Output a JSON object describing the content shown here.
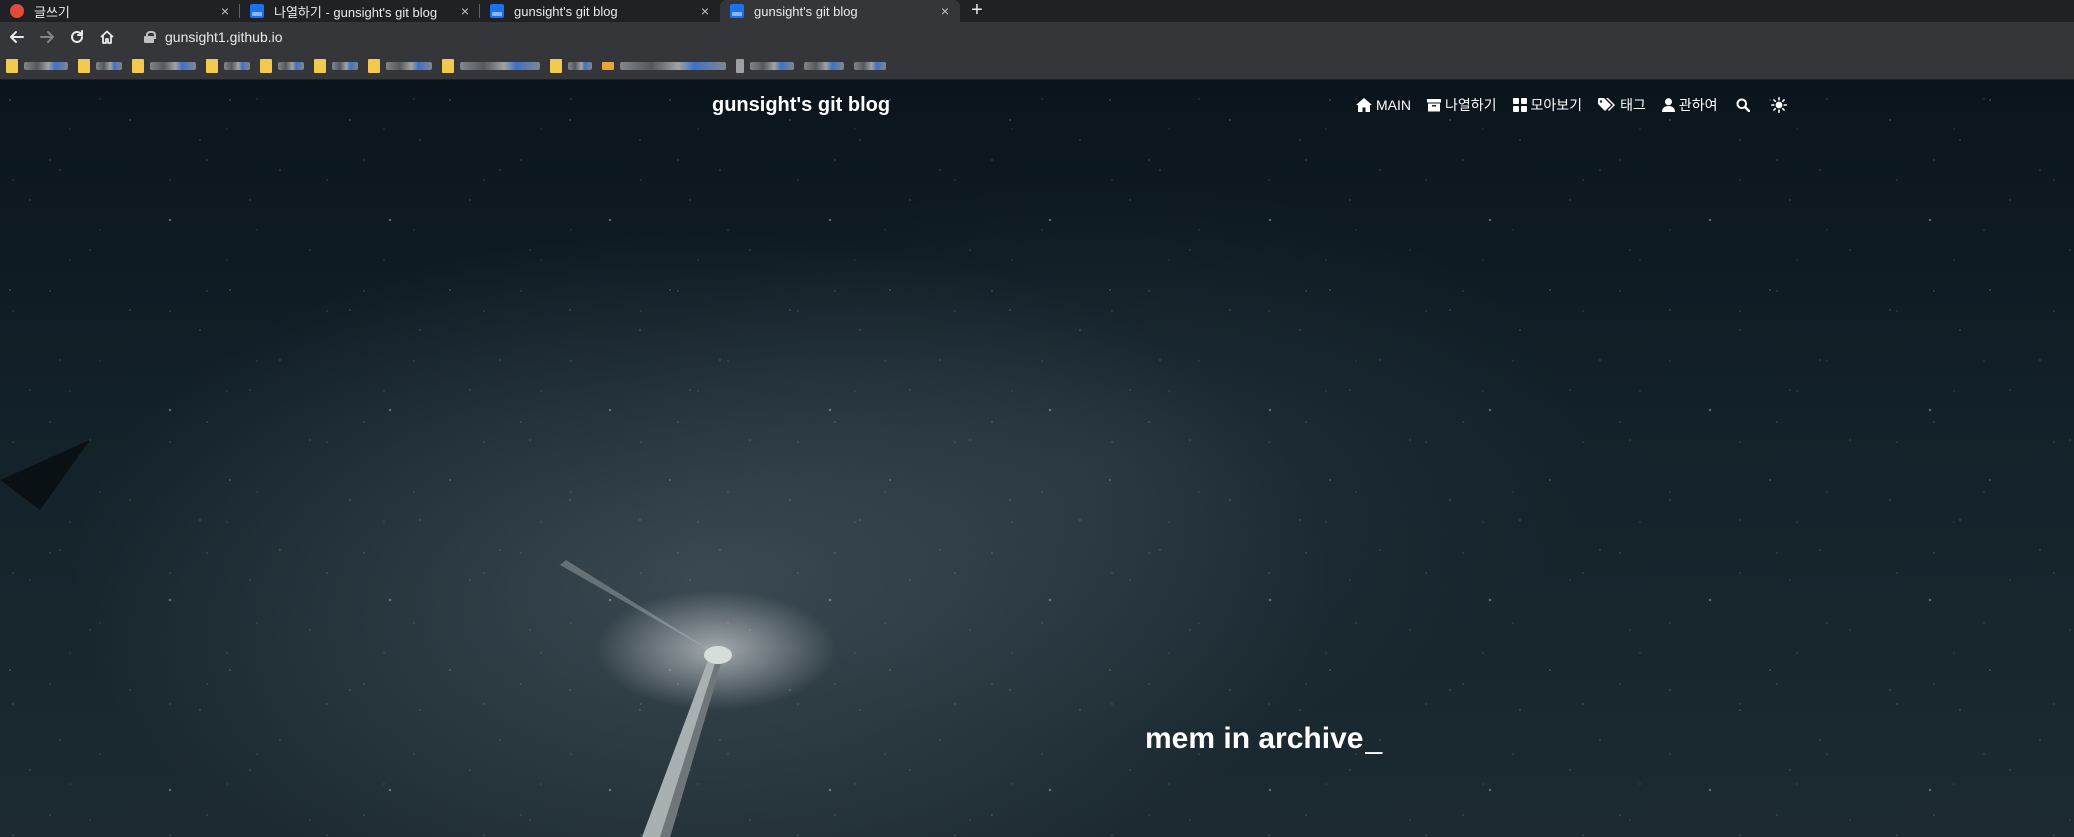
{
  "browser": {
    "tabs": [
      {
        "title": "글쓰기",
        "favicon": "red-circle-icon",
        "active": false
      },
      {
        "title": "나열하기 - gunsight's git blog",
        "favicon": "blog-icon",
        "active": false
      },
      {
        "title": "gunsight's git blog",
        "favicon": "blog-icon",
        "active": false
      },
      {
        "title": "gunsight's git blog",
        "favicon": "blog-icon",
        "active": true
      }
    ],
    "close_glyph": "×",
    "new_tab_glyph": "+",
    "url": "gunsight1.github.io"
  },
  "site": {
    "title": "gunsight's git blog",
    "nav": [
      {
        "label": "MAIN",
        "icon": "home-icon"
      },
      {
        "label": "나열하기",
        "icon": "archive-icon"
      },
      {
        "label": "모아보기",
        "icon": "grid-icon"
      },
      {
        "label": "태그",
        "icon": "tags-icon"
      },
      {
        "label": "관하여",
        "icon": "user-icon"
      }
    ],
    "search_icon": "search-icon",
    "theme_icon": "sun-icon"
  },
  "hero": {
    "text": "mem in archive",
    "cursor": "_"
  },
  "colors": {
    "tab_bg": "#202124",
    "toolbar_bg": "#35363a",
    "folder": "#f2c94c",
    "text": "#ffffff"
  }
}
